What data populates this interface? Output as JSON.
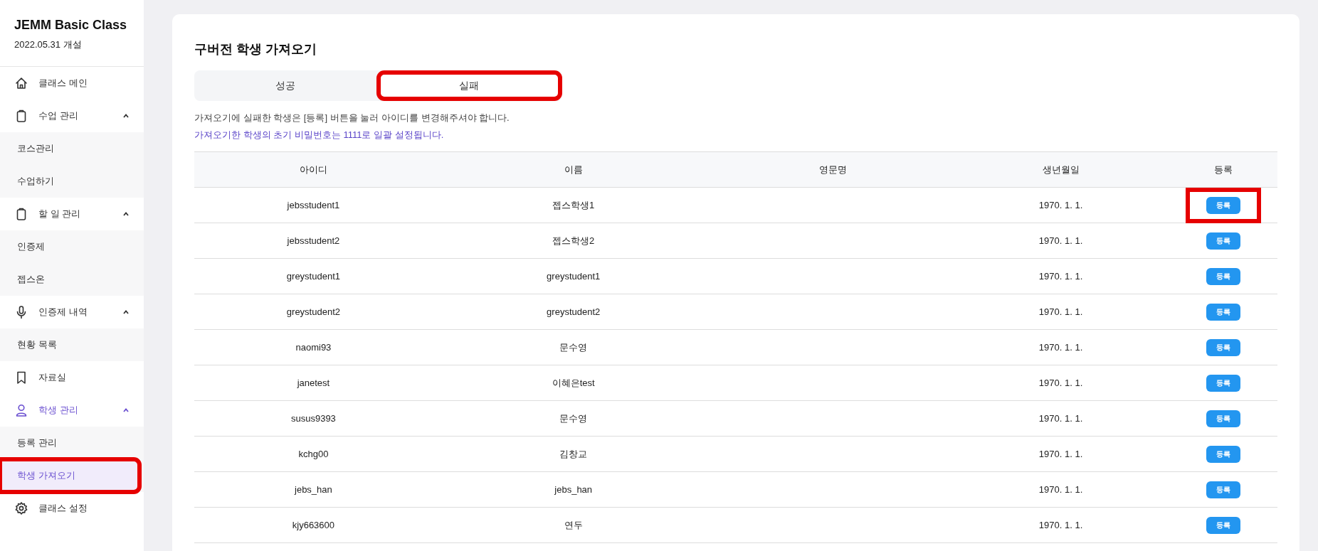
{
  "sidebar": {
    "class_title": "JEMM Basic Class",
    "opened": "2022.05.31 개설",
    "items": [
      {
        "label": "클래스 메인",
        "selected": false
      },
      {
        "label": "수업 관리",
        "selected": false,
        "expanded": true,
        "children": [
          {
            "label": "코스관리",
            "selected": false,
            "highlighted": false
          },
          {
            "label": "수업하기",
            "selected": false,
            "highlighted": false
          }
        ]
      },
      {
        "label": "할 일 관리",
        "selected": false,
        "expanded": true,
        "children": [
          {
            "label": "인증제",
            "selected": false,
            "highlighted": false
          },
          {
            "label": "젭스온",
            "selected": false,
            "highlighted": false
          }
        ]
      },
      {
        "label": "인증제 내역",
        "selected": false,
        "expanded": true,
        "children": [
          {
            "label": "현황 목록",
            "selected": false,
            "highlighted": false
          }
        ]
      },
      {
        "label": "자료실",
        "selected": false
      },
      {
        "label": "학생 관리",
        "selected": true,
        "expanded": true,
        "children": [
          {
            "label": "등록 관리",
            "selected": false,
            "highlighted": false
          },
          {
            "label": "학생 가져오기",
            "selected": true,
            "highlighted": true
          }
        ]
      },
      {
        "label": "클래스 설정",
        "selected": false
      }
    ]
  },
  "main": {
    "title": "구버전 학생 가져오기",
    "tabs": [
      {
        "label": "성공",
        "selected": false,
        "highlighted": false
      },
      {
        "label": "실패",
        "selected": true,
        "highlighted": true
      }
    ],
    "notice": "가져오기에 실패한 학생은 [등록] 버튼을 눌러 아이디를 변경해주셔야 합니다.",
    "password_notice": "가져오기한 학생의 초기 비밀번호는 1111로 일괄 설정됩니다.",
    "table": {
      "columns": [
        "아이디",
        "이름",
        "영문명",
        "생년월일",
        "등록"
      ],
      "rows": [
        {
          "id": "jebsstudent1",
          "name": "젭스학생1",
          "english_name": "",
          "birth": "1970. 1. 1.",
          "button": "등록",
          "highlighted": true
        },
        {
          "id": "jebsstudent2",
          "name": "젭스학생2",
          "english_name": "",
          "birth": "1970. 1. 1.",
          "button": "등록",
          "highlighted": false
        },
        {
          "id": "greystudent1",
          "name": "greystudent1",
          "english_name": "",
          "birth": "1970. 1. 1.",
          "button": "등록",
          "highlighted": false
        },
        {
          "id": "greystudent2",
          "name": "greystudent2",
          "english_name": "",
          "birth": "1970. 1. 1.",
          "button": "등록",
          "highlighted": false
        },
        {
          "id": "naomi93",
          "name": "문수영",
          "english_name": "",
          "birth": "1970. 1. 1.",
          "button": "등록",
          "highlighted": false
        },
        {
          "id": "janetest",
          "name": "이혜은test",
          "english_name": "",
          "birth": "1970. 1. 1.",
          "button": "등록",
          "highlighted": false
        },
        {
          "id": "susus9393",
          "name": "문수영",
          "english_name": "",
          "birth": "1970. 1. 1.",
          "button": "등록",
          "highlighted": false
        },
        {
          "id": "kchg00",
          "name": "김창교",
          "english_name": "",
          "birth": "1970. 1. 1.",
          "button": "등록",
          "highlighted": false
        },
        {
          "id": "jebs_han",
          "name": "jebs_han",
          "english_name": "",
          "birth": "1970. 1. 1.",
          "button": "등록",
          "highlighted": false
        },
        {
          "id": "kjy663600",
          "name": "연두",
          "english_name": "",
          "birth": "1970. 1. 1.",
          "button": "등록",
          "highlighted": false
        }
      ]
    }
  }
}
